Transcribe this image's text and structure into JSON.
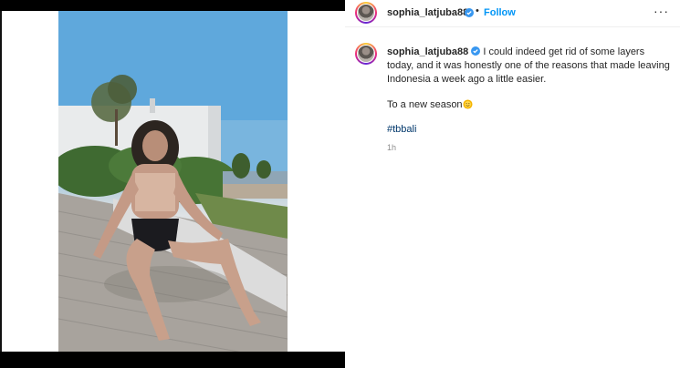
{
  "post": {
    "username": "sophia_latjuba88",
    "follow_label": "Follow",
    "separator": "•",
    "more_label": "···",
    "caption_line1": "I could indeed get rid of some layers today, and it was honestly one of the reasons that made leaving Indonesia a week ago a little easier.",
    "caption_line2": "To a new season",
    "hashtag": "#tbbali",
    "timestamp": "1h"
  },
  "icons": {
    "verified": "verified-badge-icon",
    "emoji": "smiling-sun-emoji-icon",
    "more": "more-options-icon"
  },
  "colors": {
    "link_blue": "#0095f6",
    "hashtag_blue": "#00376b",
    "text": "#262626",
    "muted": "#8e8e8e"
  }
}
